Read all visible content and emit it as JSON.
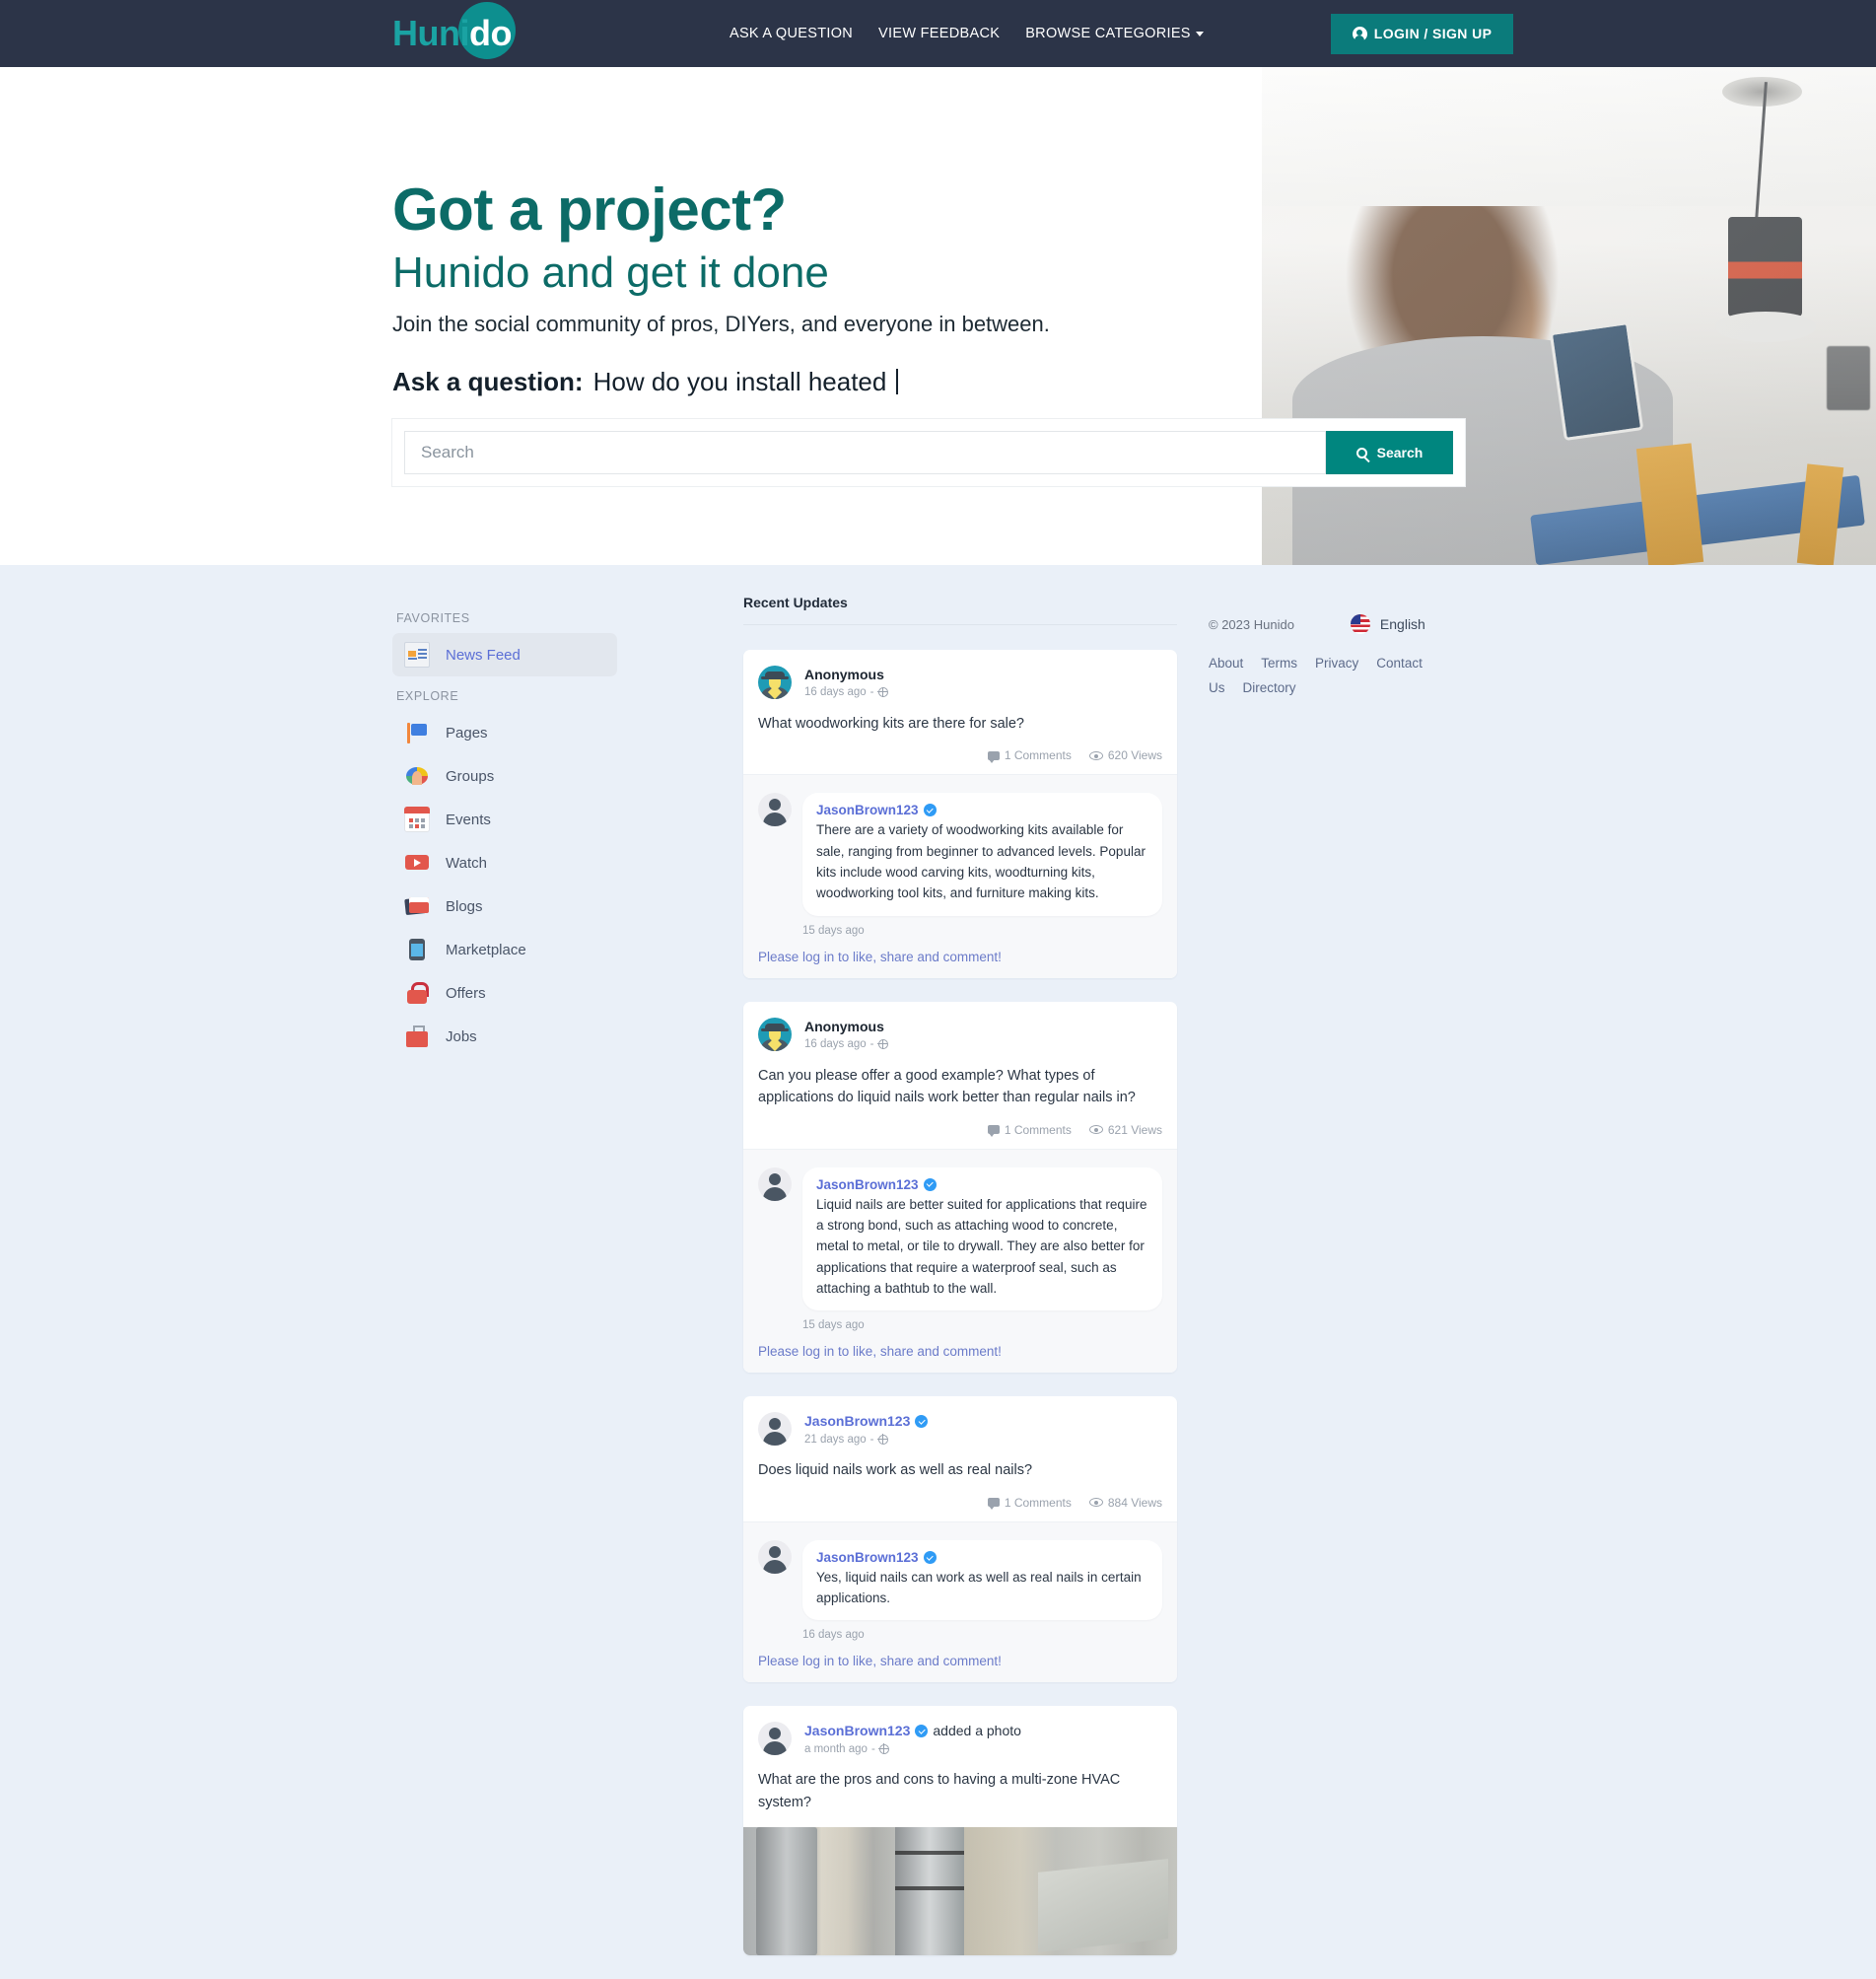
{
  "navbar": {
    "brand_prefix": "Huni",
    "brand_suffix": "do",
    "links": [
      {
        "label": "ASK A QUESTION",
        "name": "nav-ask-a-question"
      },
      {
        "label": "VIEW FEEDBACK",
        "name": "nav-view-feedback"
      },
      {
        "label": "BROWSE CATEGORIES",
        "name": "nav-browse-categories"
      }
    ],
    "login_label": "LOGIN / SIGN UP"
  },
  "hero": {
    "headline": "Got a project?",
    "subheadline": "Hunido and get it done",
    "tagline": "Join the social community of pros, DIYers, and everyone in between.",
    "ask_label": "Ask a question:",
    "ask_typed": "How do you install heated",
    "search_placeholder": "Search",
    "search_value": "",
    "search_button": "Search"
  },
  "sidebar": {
    "favorites_header": "FAVORITES",
    "explore_header": "EXPLORE",
    "favorites": [
      {
        "label": "News Feed",
        "icon": "news-feed-icon",
        "active": true
      }
    ],
    "explore": [
      {
        "label": "Pages",
        "icon": "pages-icon"
      },
      {
        "label": "Groups",
        "icon": "groups-icon"
      },
      {
        "label": "Events",
        "icon": "events-icon"
      },
      {
        "label": "Watch",
        "icon": "watch-icon"
      },
      {
        "label": "Blogs",
        "icon": "blogs-icon"
      },
      {
        "label": "Marketplace",
        "icon": "marketplace-icon"
      },
      {
        "label": "Offers",
        "icon": "offers-icon"
      },
      {
        "label": "Jobs",
        "icon": "jobs-icon"
      }
    ]
  },
  "feed": {
    "title": "Recent Updates",
    "login_prompt": "Please log in to like, share and comment!",
    "posts": [
      {
        "author": "Anonymous",
        "author_type": "anonymous",
        "verified": false,
        "time": "16 days ago",
        "action": "",
        "text": "What woodworking kits are there for sale?",
        "comments": "1 Comments",
        "views": "620 Views",
        "comment": {
          "author": "JasonBrown123",
          "verified": true,
          "text": "There are a variety of woodworking kits available for sale, ranging from beginner to advanced levels. Popular kits include wood carving kits, woodturning kits, woodworking tool kits, and furniture making kits.",
          "time": "15 days ago"
        }
      },
      {
        "author": "Anonymous",
        "author_type": "anonymous",
        "verified": false,
        "time": "16 days ago",
        "action": "",
        "text": "Can you please offer a good example? What types of applications do liquid nails work better than regular nails in?",
        "comments": "1 Comments",
        "views": "621 Views",
        "comment": {
          "author": "JasonBrown123",
          "verified": true,
          "text": "Liquid nails are better suited for applications that require a strong bond, such as attaching wood to concrete, metal to metal, or tile to drywall. They are also better for applications that require a waterproof seal, such as attaching a bathtub to the wall.",
          "time": "15 days ago"
        }
      },
      {
        "author": "JasonBrown123",
        "author_type": "user",
        "verified": true,
        "time": "21 days ago",
        "action": "",
        "text": "Does liquid nails work as well as real nails?",
        "comments": "1 Comments",
        "views": "884 Views",
        "comment": {
          "author": "JasonBrown123",
          "verified": true,
          "text": "Yes, liquid nails can work as well as real nails in certain applications.",
          "time": "16 days ago"
        }
      },
      {
        "author": "JasonBrown123",
        "author_type": "user",
        "verified": true,
        "time": "a month ago",
        "action": "added a photo",
        "text": "What are the pros and cons to having a multi-zone HVAC system?",
        "comments": "",
        "views": "",
        "has_photo": true
      }
    ]
  },
  "footer": {
    "copyright": "© 2023 Hunido",
    "language": "English",
    "links": [
      "About",
      "Terms",
      "Privacy",
      "Contact Us",
      "Directory"
    ]
  },
  "colors": {
    "navbar_bg": "#2c3448",
    "brand_teal": "#1aa3a3",
    "accent_teal": "#00867f",
    "heading_teal": "#0c6b67",
    "page_bg": "#eaf0f8",
    "link_blue": "#5b6fd6",
    "verified_blue": "#2f9bf5"
  }
}
